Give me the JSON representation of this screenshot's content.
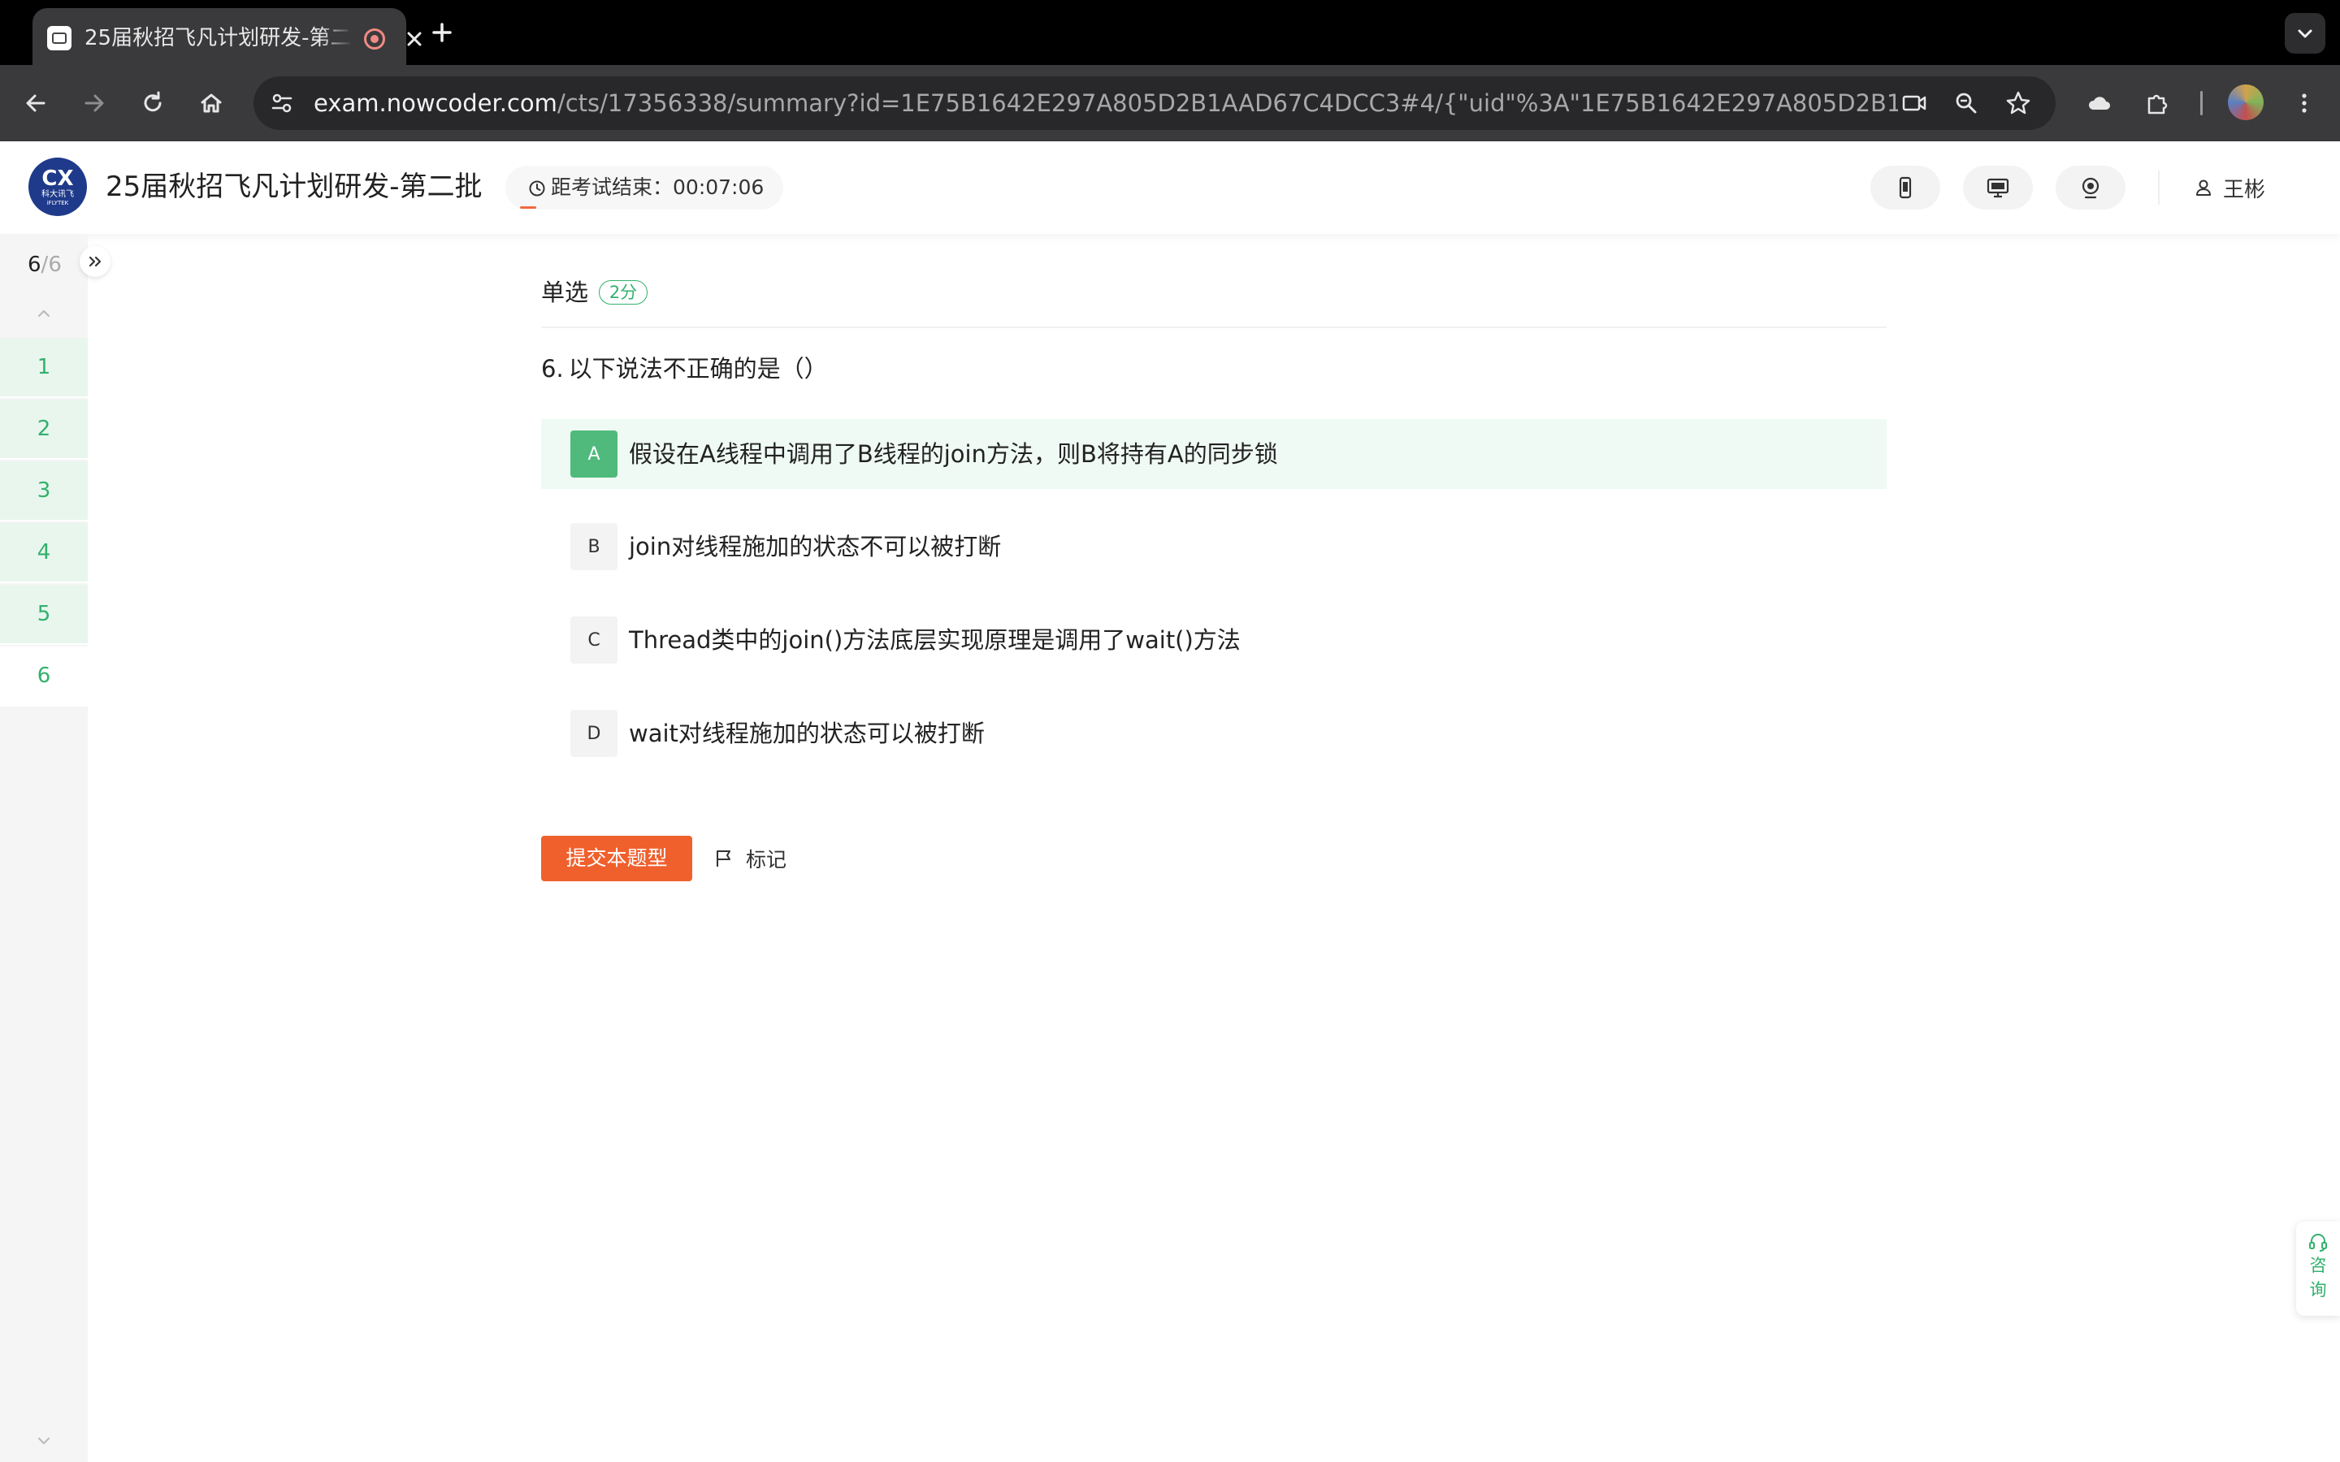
{
  "browser": {
    "tab_title": "25届秋招飞凡计划研发-第二批",
    "url_host": "exam.nowcoder.com",
    "url_path": "/cts/17356338/summary?id=1E75B1642E297A805D2B1AAD67C4DCC3#4/{\"uid\"%3A\"1E75B1642E297A805D2B1AAD67C4D..."
  },
  "header": {
    "logo_mark": "CX",
    "logo_brand": "科大讯飞",
    "logo_brand_en": "iFLYTEK",
    "exam_title": "25届秋招飞凡计划研发-第二批",
    "timer_label": "距考试结束：",
    "timer_value": "00:07:06",
    "user_name": "王彬"
  },
  "nav": {
    "current": "6",
    "separator": "/",
    "total": "6",
    "questions": [
      "1",
      "2",
      "3",
      "4",
      "5",
      "6"
    ],
    "current_index": 6
  },
  "question": {
    "type": "单选",
    "score": "2分",
    "number": "6.",
    "stem": "以下说法不正确的是（）",
    "options": [
      {
        "letter": "A",
        "text": "假设在A线程中调用了B线程的join方法，则B将持有A的同步锁",
        "selected": true
      },
      {
        "letter": "B",
        "text": "join对线程施加的状态不可以被打断",
        "selected": false
      },
      {
        "letter": "C",
        "text": "Thread类中的join()方法底层实现原理是调用了wait()方法",
        "selected": false
      },
      {
        "letter": "D",
        "text": "wait对线程施加的状态可以被打断",
        "selected": false
      }
    ],
    "submit_label": "提交本题型",
    "mark_label": "标记"
  },
  "consult": {
    "char1": "咨",
    "char2": "询"
  },
  "colors": {
    "accent_green": "#32b16c",
    "submit_orange": "#f0602d",
    "selected_bg": "#effaf4"
  },
  "icons": {
    "favicon": "nowcoder-favicon",
    "recording": "recording-icon",
    "back": "arrow-left-icon",
    "forward": "arrow-right-icon",
    "reload": "reload-icon",
    "home": "home-icon",
    "site_info": "tune-icon",
    "camera": "video-camera-icon",
    "zoom": "zoom-icon",
    "bookmark": "star-icon",
    "cloud": "cloud-icon",
    "extensions": "puzzle-icon",
    "menu": "kebab-menu-icon",
    "clock": "clock-icon",
    "phone": "phone-icon",
    "monitor": "monitor-icon",
    "webcam": "webcam-icon",
    "user": "user-icon",
    "flag": "flag-icon",
    "headset": "headset-icon"
  }
}
